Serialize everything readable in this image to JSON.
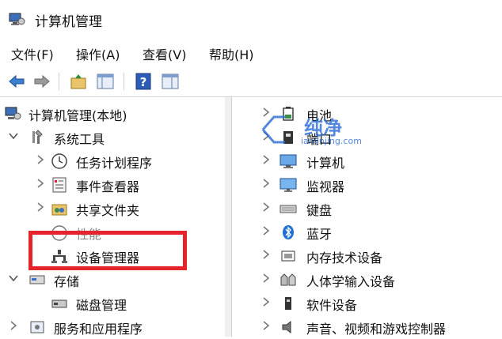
{
  "window": {
    "title": "计算机管理"
  },
  "menu": [
    "文件(F)",
    "操作(A)",
    "查看(V)",
    "帮助(H)"
  ],
  "toolbar": {
    "icons": [
      "back-arrow-icon",
      "forward-arrow-icon",
      "folder-up-icon",
      "show-hide-tree-icon",
      "help-icon",
      "properties-icon"
    ]
  },
  "tree": {
    "root": "计算机管理(本地)",
    "system_tools": "系统工具",
    "task_scheduler": "任务计划程序",
    "event_viewer": "事件查看器",
    "shared_folders": "共享文件夹",
    "performance": "性能",
    "device_manager": "设备管理器",
    "storage": "存储",
    "disk_management": "磁盘管理",
    "services_apps": "服务和应用程序"
  },
  "devices": [
    {
      "label": "电池",
      "icon": "battery-icon"
    },
    {
      "label": "端口",
      "icon": "port-icon"
    },
    {
      "label": "计算机",
      "icon": "computer-icon"
    },
    {
      "label": "监视器",
      "icon": "monitor-icon"
    },
    {
      "label": "键盘",
      "icon": "keyboard-icon"
    },
    {
      "label": "蓝牙",
      "icon": "bluetooth-icon"
    },
    {
      "label": "内存技术设备",
      "icon": "memory-icon"
    },
    {
      "label": "人体学输入设备",
      "icon": "hid-icon"
    },
    {
      "label": "软件设备",
      "icon": "software-device-icon"
    },
    {
      "label": "声音、视频和游戏控制器",
      "icon": "sound-icon"
    }
  ],
  "watermark": {
    "text": "纯净",
    "sub": "ianlinjing.com"
  },
  "colors": {
    "highlight": "#e4232c",
    "accent": "#2a6bd6"
  }
}
